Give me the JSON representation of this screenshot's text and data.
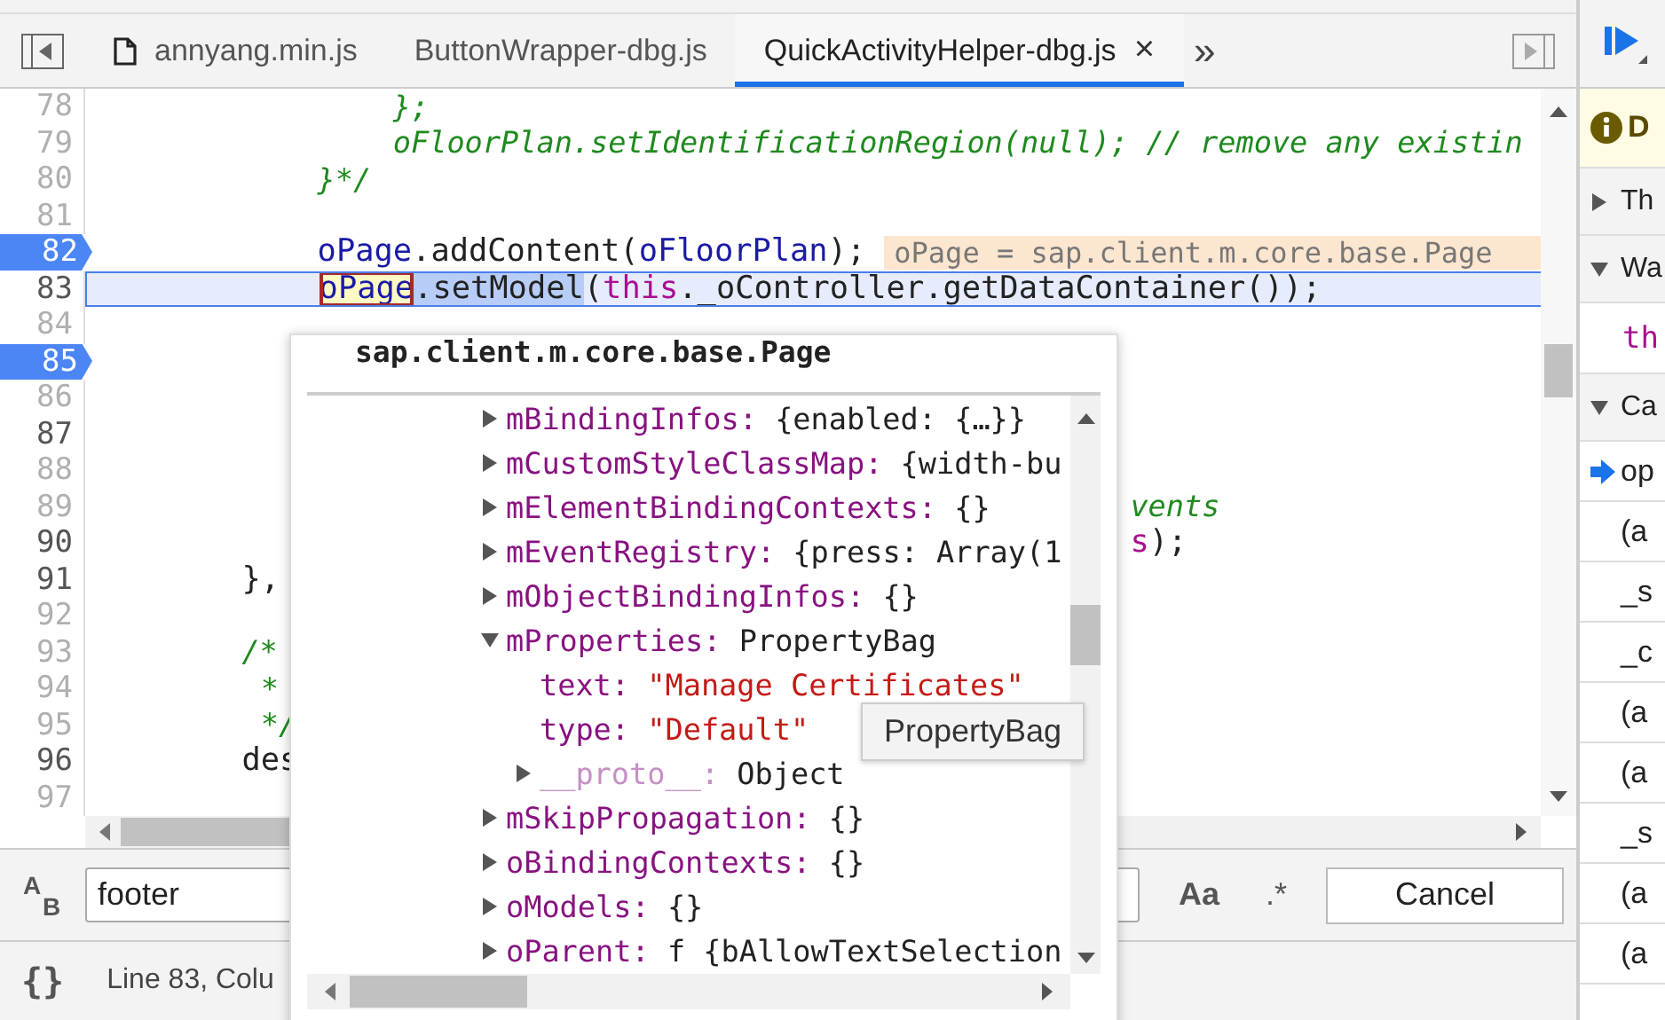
{
  "tabs": {
    "items": [
      {
        "label": "annyang.min.js",
        "kind": "file",
        "selected": false
      },
      {
        "label": "ButtonWrapper-dbg.js",
        "kind": "plain",
        "selected": false
      },
      {
        "label": "QuickActivityHelper-dbg.js",
        "kind": "plain",
        "selected": true,
        "close": "×"
      }
    ],
    "overflow": "»"
  },
  "editor": {
    "lines": [
      {
        "number": "78",
        "executable": false,
        "breakpoint": false,
        "current": false,
        "segments": [
          {
            "kind": "comment",
            "text": "                };"
          }
        ]
      },
      {
        "number": "79",
        "executable": false,
        "breakpoint": false,
        "current": false,
        "segments": [
          {
            "kind": "comment",
            "text": "                oFloorPlan.setIdentificationRegion(null); // remove any existin"
          }
        ]
      },
      {
        "number": "80",
        "executable": false,
        "breakpoint": false,
        "current": false,
        "segments": [
          {
            "kind": "comment",
            "text": "            }*/"
          }
        ]
      },
      {
        "number": "81",
        "executable": false,
        "breakpoint": false,
        "current": false
      },
      {
        "number": "82",
        "executable": true,
        "breakpoint": true,
        "current": false,
        "segments": [
          {
            "kind": "variable",
            "text": "            oPage"
          },
          {
            "kind": "plain",
            "text": ".addContent("
          },
          {
            "kind": "variable",
            "text": "oFloorPlan"
          },
          {
            "kind": "plain",
            "text": ");"
          }
        ],
        "inline_value": "oPage = sap.client.m.core.base.Page"
      },
      {
        "number": "83",
        "executable": true,
        "breakpoint": false,
        "current": true,
        "segments": [
          {
            "kind": "hovered",
            "text": "            oPage"
          },
          {
            "kind": "selection",
            "text": ".setModel"
          },
          {
            "kind": "plain",
            "text": "("
          },
          {
            "kind": "keyword",
            "text": "this"
          },
          {
            "kind": "plain",
            "text": "._oController.getDataContainer());"
          }
        ]
      },
      {
        "number": "84",
        "executable": false,
        "breakpoint": false,
        "current": false
      },
      {
        "number": "85",
        "executable": true,
        "breakpoint": true,
        "current": false
      },
      {
        "number": "86",
        "executable": false,
        "breakpoint": false,
        "current": false
      },
      {
        "number": "87",
        "executable": true,
        "breakpoint": false,
        "current": false
      },
      {
        "number": "88",
        "executable": false,
        "breakpoint": false,
        "current": false
      },
      {
        "number": "89",
        "executable": false,
        "breakpoint": false,
        "current": false,
        "segments": [
          {
            "kind": "comment",
            "text": "                                                       vents"
          }
        ]
      },
      {
        "number": "90",
        "executable": true,
        "breakpoint": false,
        "current": false,
        "segments": [
          {
            "kind": "keyword",
            "text": "                                                       s"
          },
          {
            "kind": "plain",
            "text": ");"
          }
        ]
      },
      {
        "number": "91",
        "executable": true,
        "breakpoint": false,
        "current": false,
        "segments": [
          {
            "kind": "plain",
            "text": "        },"
          }
        ]
      },
      {
        "number": "92",
        "executable": false,
        "breakpoint": false,
        "current": false
      },
      {
        "number": "93",
        "executable": false,
        "breakpoint": false,
        "current": false,
        "segments": [
          {
            "kind": "comment",
            "text": "        /*"
          }
        ]
      },
      {
        "number": "94",
        "executable": false,
        "breakpoint": false,
        "current": false,
        "segments": [
          {
            "kind": "comment",
            "text": "         *"
          }
        ]
      },
      {
        "number": "95",
        "executable": false,
        "breakpoint": false,
        "current": false,
        "segments": [
          {
            "kind": "comment",
            "text": "         */"
          }
        ]
      },
      {
        "number": "96",
        "executable": true,
        "breakpoint": false,
        "current": false,
        "segments": [
          {
            "kind": "plain",
            "text": "        des"
          }
        ]
      },
      {
        "number": "97",
        "executable": false,
        "breakpoint": false,
        "current": false
      }
    ]
  },
  "popover": {
    "title": "sap.client.m.core.base.Page",
    "tooltip": "PropertyBag",
    "tree": [
      {
        "key": "mBindingInfos:",
        "value": "{enabled: {…}}",
        "kind": "object",
        "expanded": false
      },
      {
        "key": "mCustomStyleClassMap:",
        "value": "{width-bu",
        "kind": "object",
        "expanded": false
      },
      {
        "key": "mElementBindingContexts:",
        "value": "{}",
        "kind": "object",
        "expanded": false
      },
      {
        "key": "mEventRegistry:",
        "value": "{press: Array(1",
        "kind": "object",
        "expanded": false
      },
      {
        "key": "mObjectBindingInfos:",
        "value": "{}",
        "kind": "object",
        "expanded": false
      },
      {
        "key": "mProperties:",
        "value": "PropertyBag",
        "kind": "object",
        "expanded": true,
        "children": [
          {
            "key": "text:",
            "value": "\"Manage Certificates\"",
            "kind": "string"
          },
          {
            "key": "type:",
            "value": "\"Default\"",
            "kind": "string"
          },
          {
            "key": "__proto__:",
            "value": "Object",
            "kind": "proto",
            "expanded": false
          }
        ]
      },
      {
        "key": "mSkipPropagation:",
        "value": "{}",
        "kind": "object",
        "expanded": false
      },
      {
        "key": "oBindingContexts:",
        "value": "{}",
        "kind": "object",
        "expanded": false
      },
      {
        "key": "oModels:",
        "value": "{}",
        "kind": "object",
        "expanded": false
      },
      {
        "key": "oParent:",
        "value": "f {bAllowTextSelection",
        "kind": "object",
        "expanded": false
      }
    ]
  },
  "search": {
    "replace_from": "A",
    "replace_to": "B",
    "value": "footer",
    "case_toggle": "Aa",
    "regex_toggle": ".*",
    "cancel": "Cancel"
  },
  "status_bar": {
    "format_toggle": "{}",
    "position": "Line 83, Colu"
  },
  "sidebar": {
    "items": [
      {
        "kind": "notice",
        "text": "D"
      },
      {
        "kind": "section",
        "text": "Th",
        "expanded": false
      },
      {
        "kind": "section",
        "text": "Wa",
        "expanded": true
      },
      {
        "kind": "watch",
        "text": "th"
      },
      {
        "kind": "section",
        "text": "Ca",
        "expanded": true
      },
      {
        "kind": "frame",
        "text": "op",
        "selected": true
      },
      {
        "kind": "frame",
        "text": "(a",
        "selected": false
      },
      {
        "kind": "frame",
        "text": "_s",
        "selected": false
      },
      {
        "kind": "frame",
        "text": "_c",
        "selected": false
      },
      {
        "kind": "frame",
        "text": "(a",
        "selected": false
      },
      {
        "kind": "frame",
        "text": "(a",
        "selected": false
      },
      {
        "kind": "frame",
        "text": "_s",
        "selected": false
      },
      {
        "kind": "frame",
        "text": "(a",
        "selected": false
      },
      {
        "kind": "frame",
        "text": "(a",
        "selected": false
      }
    ]
  }
}
